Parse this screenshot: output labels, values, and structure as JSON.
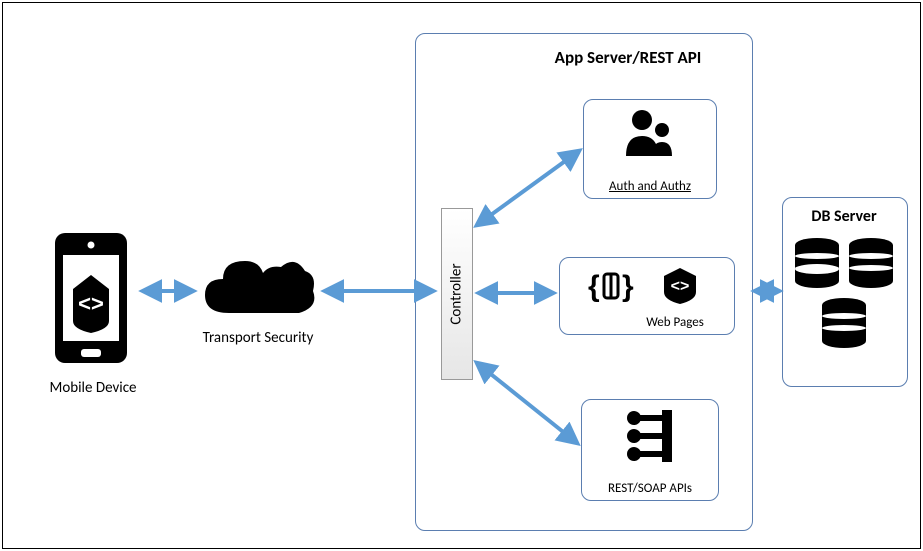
{
  "labels": {
    "mobile": "Mobile Device",
    "transport": "Transport Security",
    "appserver": "App Server/REST API",
    "controller": "Controller",
    "auth": "Auth and Authz",
    "web": "Web Pages",
    "rest": "REST/SOAP  APIs",
    "db": "DB Server"
  }
}
